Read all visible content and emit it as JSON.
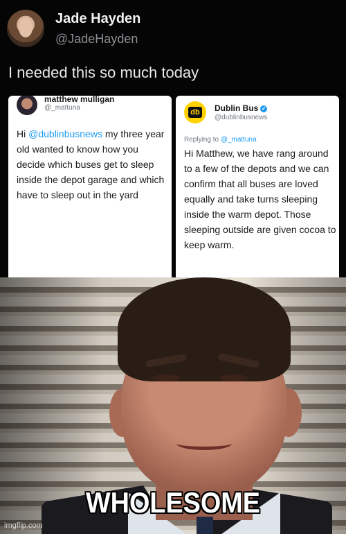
{
  "outer_tweet": {
    "display_name": "Jade Hayden",
    "handle": "@JadeHayden",
    "text": "I needed this so much today"
  },
  "embedded_tweets": {
    "left": {
      "display_name": "matthew mulligan",
      "handle": "@_mattuna",
      "body_prefix": "Hi ",
      "mention": "@dublinbusnews",
      "body_suffix": " my three year old wanted to know how you decide which buses get to sleep inside the depot garage and which have to sleep out in the yard"
    },
    "right": {
      "display_name": "Dublin Bus",
      "handle": "@dublinbusnews",
      "replying_label": "Replying to ",
      "replying_to": "@_mattuna",
      "body": "Hi Matthew, we have rang around to a few of the depots and we can confirm that all buses are loved equally and take turns sleeping inside the warm depot. Those sleeping outside are given cocoa to keep warm.",
      "verified_icon": "verified-badge-icon",
      "logo_icon": "dublin-bus-logo-icon"
    }
  },
  "meme": {
    "caption": "WHOLESOME",
    "watermark": "imgflip.com"
  },
  "colors": {
    "background": "#000000",
    "link": "#1d9bf0"
  }
}
